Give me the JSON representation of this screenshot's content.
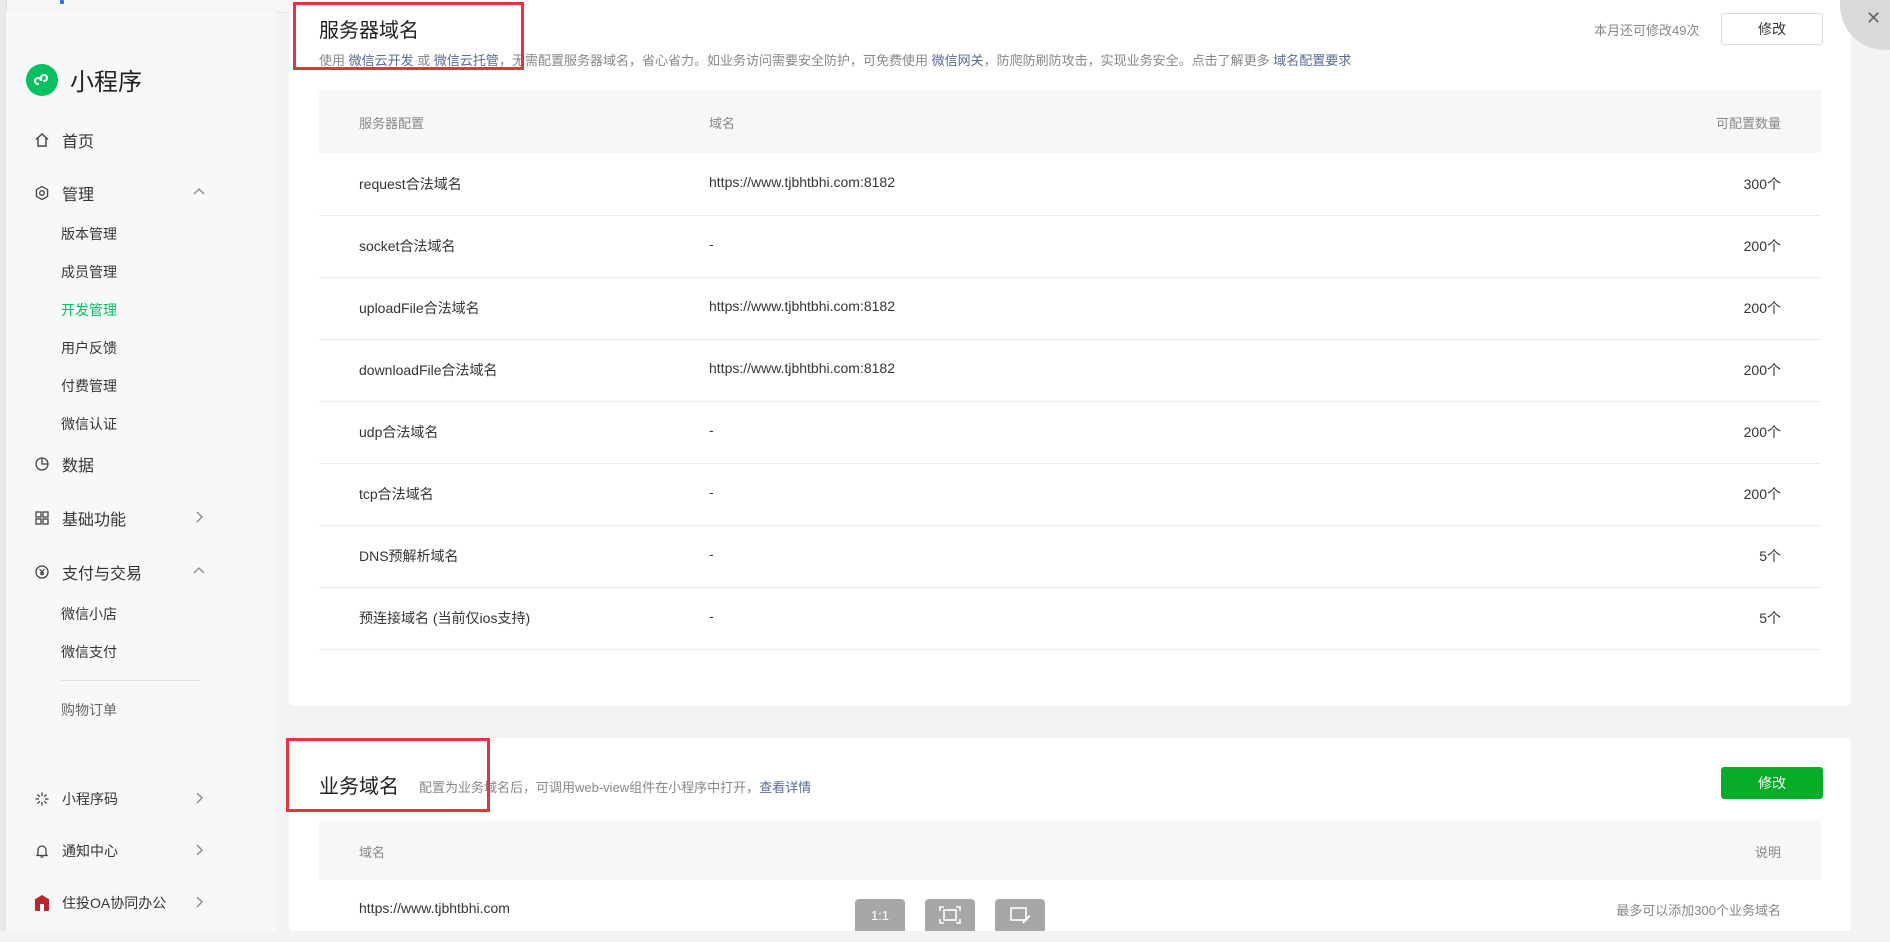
{
  "sidebar": {
    "app_name": "小程序",
    "nav": {
      "home": "首页",
      "manage": "管理",
      "data": "数据",
      "basic": "基础功能",
      "pay": "支付与交易",
      "code": "小程序码",
      "notice": "通知中心",
      "oa": "住投OA协同办公"
    },
    "manage_sub": [
      "版本管理",
      "成员管理",
      "开发管理",
      "用户反馈",
      "付费管理",
      "微信认证"
    ],
    "pay_sub": [
      "微信小店",
      "微信支付",
      "购物订单"
    ],
    "active_sub": "开发管理"
  },
  "server_domains": {
    "title": "服务器域名",
    "desc_prefix": "使用",
    "link_cloud_dev": "微信云开发",
    "desc_or": "或",
    "link_cloud_host": "微信云托管",
    "desc_mid": "，无需配置服务器域名，省心省力。如业务访问需要安全防护，可免费使用",
    "link_gateway": "微信网关",
    "desc_end": "，防爬防刷防攻击，实现业务安全。点击了解更多",
    "link_req": "域名配置要求",
    "quota": "本月还可修改49次",
    "modify_label": "修改",
    "headers": {
      "config": "服务器配置",
      "domain": "域名",
      "count": "可配置数量"
    },
    "rows": [
      {
        "config": "request合法域名",
        "domain": "https://www.tjbhtbhi.com:8182",
        "count": "300个"
      },
      {
        "config": "socket合法域名",
        "domain": "-",
        "count": "200个"
      },
      {
        "config": "uploadFile合法域名",
        "domain": "https://www.tjbhtbhi.com:8182",
        "count": "200个"
      },
      {
        "config": "downloadFile合法域名",
        "domain": "https://www.tjbhtbhi.com:8182",
        "count": "200个"
      },
      {
        "config": "udp合法域名",
        "domain": "-",
        "count": "200个"
      },
      {
        "config": "tcp合法域名",
        "domain": "-",
        "count": "200个"
      },
      {
        "config": "DNS预解析域名",
        "domain": "-",
        "count": "5个"
      },
      {
        "config": "预连接域名 (当前仅ios支持)",
        "domain": "-",
        "count": "5个"
      }
    ]
  },
  "business_domains": {
    "title": "业务域名",
    "desc": "配置为业务域名后，可调用web-view组件在小程序中打开，",
    "link_detail": "查看详情",
    "modify_label": "修改",
    "headers": {
      "domain": "域名",
      "note": "说明"
    },
    "row": {
      "domain": "https://www.tjbhtbhi.com",
      "note": "最多可以添加300个业务域名"
    }
  },
  "toolbar": {
    "ratio_label": "1:1"
  },
  "colors": {
    "brand_green": "#07c160",
    "primary_button": "#07ad27",
    "link": "#576b95",
    "annotation_red": "#e8333f"
  }
}
